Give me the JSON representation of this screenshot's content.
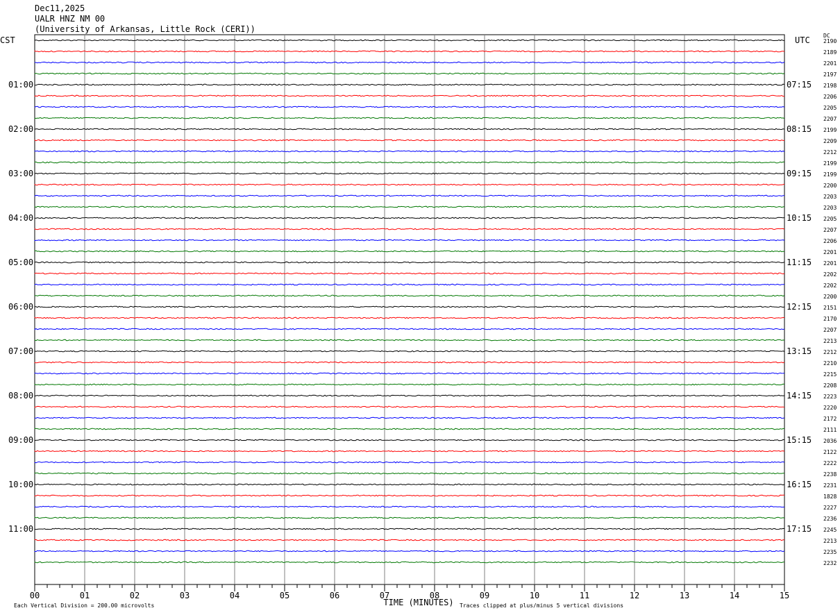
{
  "header": {
    "date": "Dec11,2025",
    "station": "UALR HNZ NM 00",
    "network": "(University of Arkansas, Little Rock (CERI))"
  },
  "chart_data": {
    "type": "line",
    "left_axis_label": "CST",
    "right_axis_label": "UTC",
    "dc_label": "DC",
    "xlabel": "TIME (MINUTES)",
    "x_ticks": [
      "00",
      "01",
      "02",
      "03",
      "04",
      "05",
      "06",
      "07",
      "08",
      "09",
      "10",
      "11",
      "12",
      "13",
      "14",
      "15"
    ],
    "xlim": [
      0,
      15
    ],
    "left_hour_labels": [
      "01:00",
      "02:00",
      "03:00",
      "04:00",
      "05:00",
      "06:00",
      "07:00",
      "08:00",
      "09:00",
      "10:00",
      "11:00"
    ],
    "right_hour_labels": [
      "07:15",
      "08:15",
      "09:15",
      "10:15",
      "11:15",
      "12:15",
      "13:15",
      "14:15",
      "15:15",
      "16:15",
      "17:15"
    ],
    "trace_colors": [
      "#000000",
      "#ff0000",
      "#0000ff",
      "#007700"
    ],
    "rows_per_hour": 4,
    "dc_values": [
      "2190",
      "2189",
      "2201",
      "2197",
      "2198",
      "2206",
      "2205",
      "2207",
      "2199",
      "2209",
      "2212",
      "2199",
      "2199",
      "2200",
      "2203",
      "2203",
      "2205",
      "2207",
      "2206",
      "2201",
      "2201",
      "2202",
      "2202",
      "2200",
      "2151",
      "2170",
      "2207",
      "2213",
      "2212",
      "2210",
      "2215",
      "2208",
      "2223",
      "2220",
      "2172",
      "2111",
      "2036",
      "2122",
      "2222",
      "2238",
      "2231",
      "1828",
      "2227",
      "2236",
      "2245",
      "2213",
      "2235",
      "2232"
    ],
    "footer_scale": "Each Vertical Division =  200.00 microvolts",
    "footer_clip": "Traces clipped at plus/minus 5 vertical divisions"
  }
}
